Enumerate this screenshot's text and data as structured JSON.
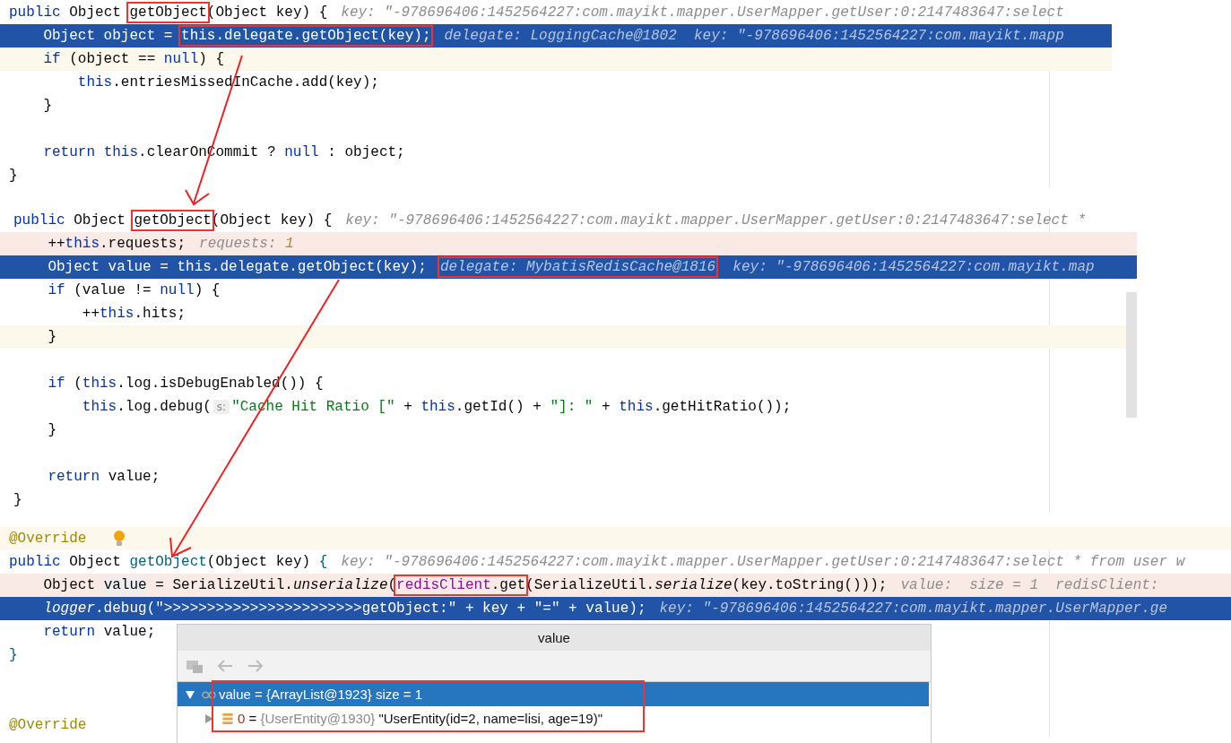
{
  "panels": [
    {
      "lines": [
        {
          "kind": "plain",
          "tokens": [
            {
              "t": "public ",
              "kind": "kw"
            },
            {
              "t": "Object ",
              "kind": "p"
            },
            {
              "t": "getObject",
              "kind": "p",
              "boxed": true
            },
            {
              "t": "(Object key) {",
              "kind": "p"
            }
          ],
          "hint": [
            {
              "t": "key: \"-978696406:1452564227:com.mayikt.mapper.UserMapper.getUser:0:2147483647:select",
              "kind": "hint"
            }
          ]
        },
        {
          "kind": "exec",
          "tokens": [
            {
              "t": "    Object object = ",
              "kind": "p"
            },
            {
              "t": "this.delegate.getObject(key);",
              "kind": "p",
              "boxed": true
            }
          ],
          "hint": [
            {
              "t": "delegate: LoggingCache@1802  key: \"-978696406:1452564227:com.mayikt.mapp",
              "kind": "hint"
            }
          ]
        },
        {
          "kind": "caret",
          "tokens": [
            {
              "t": "    if",
              "kind": "kw"
            },
            {
              "t": " (object == ",
              "kind": "p"
            },
            {
              "t": "null",
              "kind": "kw"
            },
            {
              "t": ") {",
              "kind": "p"
            }
          ]
        },
        {
          "kind": "plain",
          "tokens": [
            {
              "t": "        this",
              "kind": "kw"
            },
            {
              "t": ".entriesMissedInCache.add(key);",
              "kind": "p"
            }
          ]
        },
        {
          "kind": "plain",
          "tokens": [
            {
              "t": "    }",
              "kind": "p"
            }
          ]
        },
        {
          "kind": "plain"
        },
        {
          "kind": "plain",
          "tokens": [
            {
              "t": "    return ",
              "kind": "kw"
            },
            {
              "t": "this",
              "kind": "kw"
            },
            {
              "t": ".clearOnCommit ? ",
              "kind": "p"
            },
            {
              "t": "null",
              "kind": "kw"
            },
            {
              "t": " : object;",
              "kind": "p"
            }
          ]
        },
        {
          "kind": "plain",
          "tokens": [
            {
              "t": "}",
              "kind": "p"
            }
          ]
        }
      ]
    },
    {
      "lines": [
        {
          "kind": "plain",
          "tokens": [
            {
              "t": "public ",
              "kind": "kw"
            },
            {
              "t": "Object ",
              "kind": "p"
            },
            {
              "t": "getObject",
              "kind": "p",
              "boxed": true
            },
            {
              "t": "(Object key) {",
              "kind": "p"
            }
          ],
          "hint": [
            {
              "t": "key: \"-978696406:1452564227:com.mayikt.mapper.UserMapper.getUser:0:2147483647:select *",
              "kind": "hint"
            }
          ]
        },
        {
          "kind": "breakpoint",
          "tokens": [
            {
              "t": "    ++",
              "kind": "p"
            },
            {
              "t": "this",
              "kind": "kw"
            },
            {
              "t": ".requests;",
              "kind": "p"
            }
          ],
          "hint": [
            {
              "t": "requests: ",
              "kind": "hint"
            },
            {
              "t": "1",
              "kind": "num"
            }
          ]
        },
        {
          "kind": "exec",
          "tokens": [
            {
              "t": "    Object value = this.delegate.getObject(key);",
              "kind": "p"
            }
          ],
          "hint": [
            {
              "t": "delegate: MybatisRedisCache@1816",
              "kind": "hint",
              "boxed": true
            },
            {
              "t": "  key: \"-978696406:1452564227:com.mayikt.map",
              "kind": "hint"
            }
          ]
        },
        {
          "kind": "plain",
          "tokens": [
            {
              "t": "    if",
              "kind": "kw"
            },
            {
              "t": " (value != ",
              "kind": "p"
            },
            {
              "t": "null",
              "kind": "kw"
            },
            {
              "t": ") {",
              "kind": "p"
            }
          ]
        },
        {
          "kind": "plain",
          "tokens": [
            {
              "t": "        ++",
              "kind": "p"
            },
            {
              "t": "this",
              "kind": "kw"
            },
            {
              "t": ".hits;",
              "kind": "p"
            }
          ]
        },
        {
          "kind": "caret",
          "tokens": [
            {
              "t": "    }",
              "kind": "p"
            }
          ]
        },
        {
          "kind": "plain"
        },
        {
          "kind": "plain",
          "tokens": [
            {
              "t": "    if",
              "kind": "kw"
            },
            {
              "t": " (",
              "kind": "p"
            },
            {
              "t": "this",
              "kind": "kw"
            },
            {
              "t": ".log.isDebugEnabled()) {",
              "kind": "p"
            }
          ]
        },
        {
          "kind": "plain",
          "tokens": [
            {
              "t": "        this",
              "kind": "kw"
            },
            {
              "t": ".log.debug(",
              "kind": "p"
            },
            {
              "t": "s:",
              "kind": "param"
            },
            {
              "t": "\"Cache Hit Ratio [\"",
              "kind": "str"
            },
            {
              "t": " + ",
              "kind": "p"
            },
            {
              "t": "this",
              "kind": "kw"
            },
            {
              "t": ".getId() + ",
              "kind": "p"
            },
            {
              "t": "\"]: \"",
              "kind": "str"
            },
            {
              "t": " + ",
              "kind": "p"
            },
            {
              "t": "this",
              "kind": "kw"
            },
            {
              "t": ".getHitRatio());",
              "kind": "p"
            }
          ]
        },
        {
          "kind": "plain",
          "tokens": [
            {
              "t": "    }",
              "kind": "p"
            }
          ]
        },
        {
          "kind": "plain"
        },
        {
          "kind": "plain",
          "tokens": [
            {
              "t": "    return ",
              "kind": "kw"
            },
            {
              "t": "value;",
              "kind": "p"
            }
          ]
        },
        {
          "kind": "plain",
          "tokens": [
            {
              "t": "}",
              "kind": "p"
            }
          ]
        }
      ]
    },
    {
      "lines": [
        {
          "kind": "caret",
          "tokens": [
            {
              "t": "@Override",
              "kind": "ann"
            }
          ],
          "bulb": true
        },
        {
          "kind": "plain",
          "tokens": [
            {
              "t": "public ",
              "kind": "kw"
            },
            {
              "t": "Object ",
              "kind": "p"
            },
            {
              "t": "getObject",
              "kind": "fn"
            },
            {
              "t": "(Object key) ",
              "kind": "p"
            },
            {
              "t": "{",
              "kind": "fn"
            }
          ],
          "hint": [
            {
              "t": "key: \"-978696406:1452564227:com.mayikt.mapper.UserMapper.getUser:0:2147483647:select * from user w",
              "kind": "hint"
            }
          ]
        },
        {
          "kind": "breakpoint",
          "tokens": [
            {
              "t": "    Object ",
              "kind": "p"
            },
            {
              "t": "value",
              "kind": "usage"
            },
            {
              "t": " = SerializeUtil.",
              "kind": "p"
            },
            {
              "t": "unserialize",
              "kind": "it"
            },
            {
              "t": "(",
              "kind": "p"
            },
            {
              "t": "redisClient",
              "kind": "field",
              "boxed": true
            },
            {
              "t": ".get",
              "kind": "p",
              "boxed": true
            },
            {
              "t": "(SerializeUtil.",
              "kind": "p"
            },
            {
              "t": "serialize",
              "kind": "it"
            },
            {
              "t": "(key.toString()));",
              "kind": "p"
            }
          ],
          "hint": [
            {
              "t": "value:  size = 1  redisClient:",
              "kind": "hint"
            }
          ]
        },
        {
          "kind": "exec",
          "tokens": [
            {
              "t": "    logger",
              "kind": "it"
            },
            {
              "t": ".debug(\">>>>>>>>>>>>>>>>>>>>>>>getObject:\" + key + \"=\" + value);",
              "kind": "p"
            }
          ],
          "hint": [
            {
              "t": "key: \"-978696406:1452564227:com.mayikt.mapper.UserMapper.ge",
              "kind": "hint"
            }
          ]
        },
        {
          "kind": "plain",
          "tokens": [
            {
              "t": "    return ",
              "kind": "kw"
            },
            {
              "t": "value;",
              "kind": "p"
            }
          ]
        },
        {
          "kind": "plain",
          "tokens": [
            {
              "t": "}",
              "kind": "fn"
            }
          ]
        },
        {
          "kind": "plain"
        },
        {
          "kind": "plain"
        },
        {
          "kind": "plain",
          "tokens": [
            {
              "t": "@Override",
              "kind": "ann"
            }
          ]
        }
      ]
    }
  ],
  "popup": {
    "title": "value",
    "outlined": true,
    "toolbar": [
      {
        "kind": "folder",
        "disabled": true
      },
      {
        "kind": "back",
        "disabled": true
      },
      {
        "kind": "forward",
        "disabled": true
      }
    ],
    "rows": [
      {
        "kind": "watch",
        "name": "value",
        "sep": " = ",
        "type": "{ArrayList@1923}",
        "value": " size = 1",
        "expanded": true,
        "selected": true,
        "children": [
          {
            "kind": "list",
            "name": "0",
            "sep": " = ",
            "type": "{UserEntity@1930}",
            "value": " \"UserEntity(id=2, name=lisi, age=19)\"",
            "expanded": false,
            "selected": false
          }
        ]
      }
    ]
  }
}
